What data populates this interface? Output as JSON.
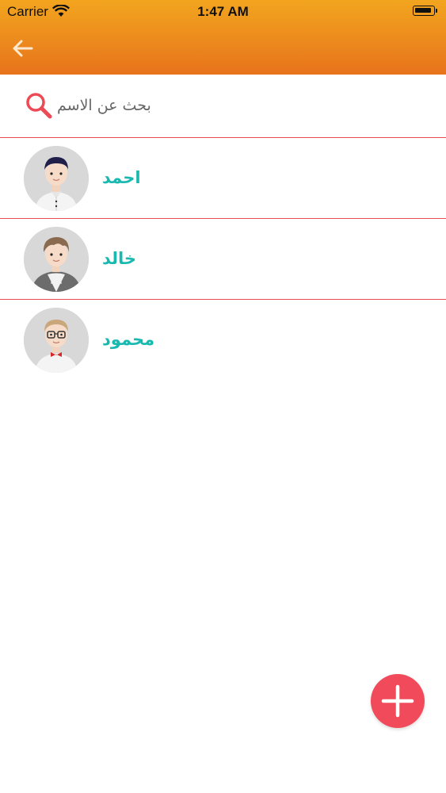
{
  "status_bar": {
    "carrier": "Carrier",
    "time": "1:47 AM"
  },
  "header": {
    "back_icon": "arrow-left-icon"
  },
  "search": {
    "placeholder": "بحث عن الاسم",
    "value": "",
    "icon": "search-icon"
  },
  "contacts": [
    {
      "name": "احمد"
    },
    {
      "name": "خالد"
    },
    {
      "name": "محمود"
    }
  ],
  "fab": {
    "icon": "plus-icon"
  },
  "colors": {
    "header_top": "#f2a51e",
    "header_bottom": "#e8731c",
    "divider": "#ec4a55",
    "name_text": "#19b9b0",
    "fab": "#f04a5b"
  }
}
